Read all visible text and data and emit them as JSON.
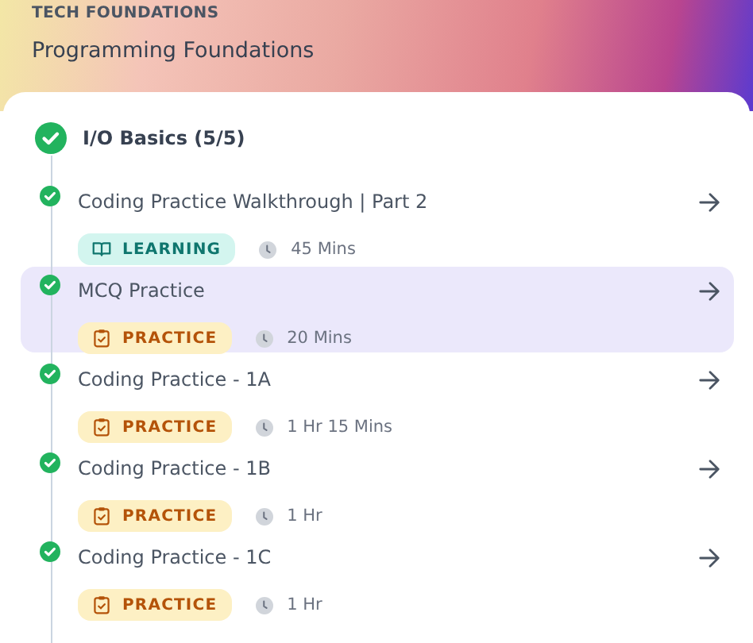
{
  "header": {
    "eyebrow": "TECH FOUNDATIONS",
    "title": "Programming Foundations"
  },
  "section": {
    "title": "I/O Basics (5/5)",
    "completed": true
  },
  "items": [
    {
      "title": "Coding Practice Walkthrough | Part 2",
      "kind": "learning",
      "tag": "LEARNING",
      "duration": "45 Mins",
      "completed": true,
      "selected": false
    },
    {
      "title": "MCQ Practice",
      "kind": "practice",
      "tag": "PRACTICE",
      "duration": "20 Mins",
      "completed": true,
      "selected": true
    },
    {
      "title": "Coding Practice - 1A",
      "kind": "practice",
      "tag": "PRACTICE",
      "duration": "1 Hr 15 Mins",
      "completed": true,
      "selected": false
    },
    {
      "title": "Coding Practice - 1B",
      "kind": "practice",
      "tag": "PRACTICE",
      "duration": "1 Hr",
      "completed": true,
      "selected": false
    },
    {
      "title": "Coding Practice - 1C",
      "kind": "practice",
      "tag": "PRACTICE",
      "duration": "1 Hr",
      "completed": true,
      "selected": false
    }
  ]
}
